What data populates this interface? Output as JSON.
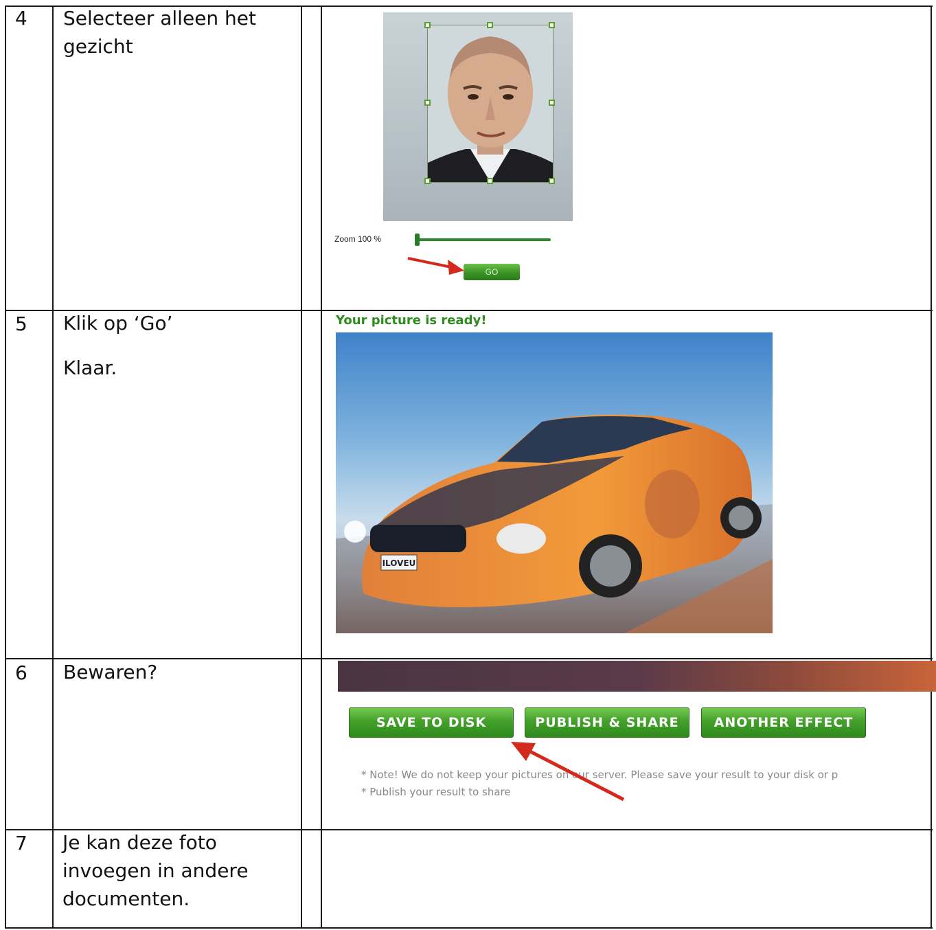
{
  "rows": [
    {
      "num": "4",
      "lines": [
        "Selecteer alleen het",
        "gezicht"
      ]
    },
    {
      "num": "5",
      "line1": "Klik op ‘Go’",
      "line2": "Klaar."
    },
    {
      "num": "6",
      "lines": [
        "Bewaren?"
      ]
    },
    {
      "num": "7",
      "lines": [
        "Je kan deze foto",
        "invoegen in andere",
        "documenten."
      ]
    }
  ],
  "crop_ui": {
    "zoom_label": "Zoom 100 %",
    "zoom_percent": 100,
    "go_label": "GO"
  },
  "result": {
    "ready_text": "Your picture is ready!",
    "plate_text": "ILOVEU"
  },
  "save_ui": {
    "buttons": [
      "SAVE TO DISK",
      "PUBLISH & SHARE",
      "ANOTHER EFFECT"
    ],
    "notes": [
      "* Note! We do not keep your pictures on our server. Please save your result to your disk or p",
      "* Publish your result to share"
    ]
  },
  "colors": {
    "button_green": "#43a02b",
    "ready_green": "#2e8b1e",
    "arrow_red": "#d42a1e",
    "grid_line": "#1a1a1a"
  }
}
